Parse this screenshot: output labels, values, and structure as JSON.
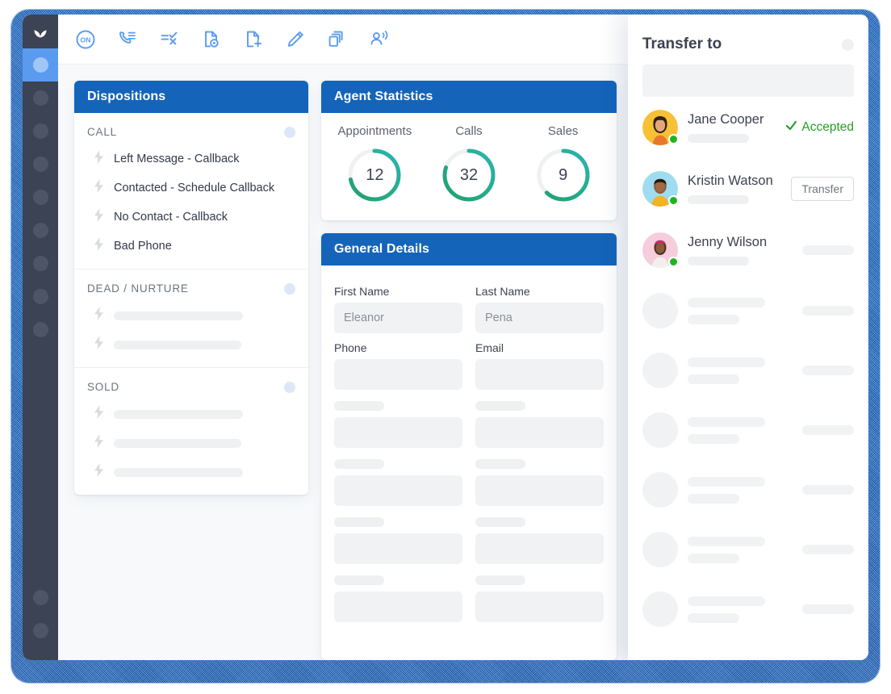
{
  "app": {
    "logo_icon": "leaf-logo"
  },
  "sidebar": {
    "items": [
      {
        "name": "nav-item-1",
        "active": true
      },
      {
        "name": "nav-item-2",
        "active": false
      },
      {
        "name": "nav-item-3",
        "active": false
      },
      {
        "name": "nav-item-4",
        "active": false
      },
      {
        "name": "nav-item-5",
        "active": false
      },
      {
        "name": "nav-item-6",
        "active": false
      },
      {
        "name": "nav-item-7",
        "active": false
      },
      {
        "name": "nav-item-8",
        "active": false
      },
      {
        "name": "nav-item-9",
        "active": false
      }
    ],
    "bottom_items": [
      {
        "name": "nav-bottom-1"
      },
      {
        "name": "nav-bottom-2"
      }
    ]
  },
  "toolbar": {
    "buttons": [
      {
        "icon": "on-status-icon",
        "label": "ON"
      },
      {
        "icon": "phone-list-icon",
        "label": "Call list"
      },
      {
        "icon": "check-cross-list-icon",
        "label": "Disposition"
      },
      {
        "icon": "document-view-icon",
        "label": "View record"
      },
      {
        "icon": "document-add-icon",
        "label": "New record"
      },
      {
        "icon": "pencil-icon",
        "label": "Edit"
      },
      {
        "icon": "copy-icon",
        "label": "Duplicate"
      },
      {
        "icon": "person-broadcast-icon",
        "label": "Transfer"
      }
    ]
  },
  "dispositions": {
    "title": "Dispositions",
    "groups": [
      {
        "title": "CALL",
        "items": [
          {
            "label": "Left Message - Callback",
            "skeleton": false
          },
          {
            "label": "Contacted - Schedule Callback",
            "skeleton": false
          },
          {
            "label": "No Contact - Callback",
            "skeleton": false
          },
          {
            "label": "Bad Phone",
            "skeleton": false
          }
        ]
      },
      {
        "title": "DEAD / NURTURE",
        "items": [
          {
            "label": "",
            "skeleton": true
          },
          {
            "label": "",
            "skeleton": true
          }
        ]
      },
      {
        "title": "SOLD",
        "items": [
          {
            "label": "",
            "skeleton": true
          },
          {
            "label": "",
            "skeleton": true
          },
          {
            "label": "",
            "skeleton": true
          }
        ]
      }
    ]
  },
  "agent_statistics": {
    "title": "Agent Statistics",
    "stats": [
      {
        "label": "Appointments",
        "value": "12",
        "percent": 72
      },
      {
        "label": "Calls",
        "value": "32",
        "percent": 80
      },
      {
        "label": "Sales",
        "value": "9",
        "percent": 62
      }
    ]
  },
  "general_details": {
    "title": "General Details",
    "fields": [
      {
        "label": "First Name",
        "value": "Eleanor"
      },
      {
        "label": "Last Name",
        "value": "Pena"
      },
      {
        "label": "Phone",
        "value": ""
      },
      {
        "label": "Email",
        "value": ""
      }
    ],
    "skeleton_rows": 4
  },
  "transfer": {
    "title": "Transfer to",
    "search_value": "",
    "contacts": [
      {
        "name": "Jane Cooper",
        "status": "Accepted",
        "action": "status",
        "avatar_bg": "#f7c035",
        "online": true
      },
      {
        "name": "Kristin Watson",
        "status": "",
        "action": "transfer",
        "button_label": "Transfer",
        "avatar_bg": "#9fdcef",
        "online": true
      },
      {
        "name": "Jenny Wilson",
        "status": "",
        "action": "skeleton",
        "avatar_bg": "#f5cddc",
        "online": true
      }
    ],
    "skeleton_rows": 6
  },
  "colors": {
    "header_blue": "#1464ba",
    "sidebar": "#3c4354",
    "accent_blue": "#5a9bef",
    "status_green": "#26a026",
    "presence_green": "#21b421",
    "donut_start": "#22a06b",
    "donut_end": "#2bb5b0",
    "frame_blue": "#1569c8"
  }
}
